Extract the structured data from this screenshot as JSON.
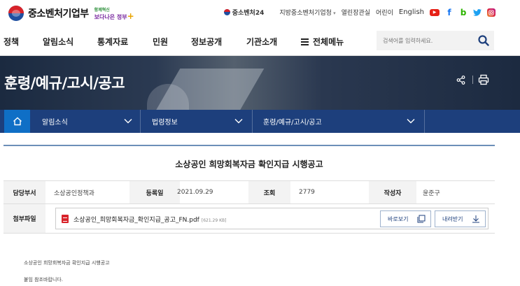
{
  "header": {
    "logo_text": "중소벤처기업부",
    "slogan_line1": "함께혁신",
    "slogan_line2": "보다나은 정부",
    "brand24": "중소벤처24",
    "links": [
      "지방중소벤처기업청",
      "열린장관실",
      "어린이"
    ],
    "english": "English",
    "sns": [
      "youtube-icon",
      "facebook-icon",
      "blog-icon",
      "twitter-icon",
      "instagram-icon"
    ]
  },
  "gnb": {
    "items": [
      "정책",
      "알림소식",
      "통계자료",
      "민원",
      "정보공개",
      "기관소개"
    ],
    "all_menu": "전체메뉴",
    "search_placeholder": "검색어를 입력하세요."
  },
  "visual": {
    "title": "훈령/예규/고시/공고"
  },
  "location": {
    "items": [
      "알림소식",
      "법령정보",
      "훈령/예규/고시/공고"
    ]
  },
  "post": {
    "title": "소상공인 희망회복자금 확인지급 시행공고",
    "labels": {
      "dept": "담당부서",
      "date": "등록일",
      "views": "조회",
      "author": "작성자",
      "attach": "첨부파일"
    },
    "dept": "소상공인정책과",
    "date": "2021.09.29",
    "views": "2779",
    "author": "윤준구",
    "file": {
      "name": "소상공인_희망회복자금_확인지급_공고_FN.pdf",
      "size": "[621.29 KB]",
      "view_label": "바로보기",
      "download_label": "내려받기"
    },
    "body": [
      "소상공인 희망회복자금 확인지급 시행공고",
      "붙임 참조바랍니다."
    ]
  },
  "colors": {
    "location_bg": "#1d3f7c",
    "home_bg": "#0f6fc6",
    "rule": "#6c8fb8"
  }
}
